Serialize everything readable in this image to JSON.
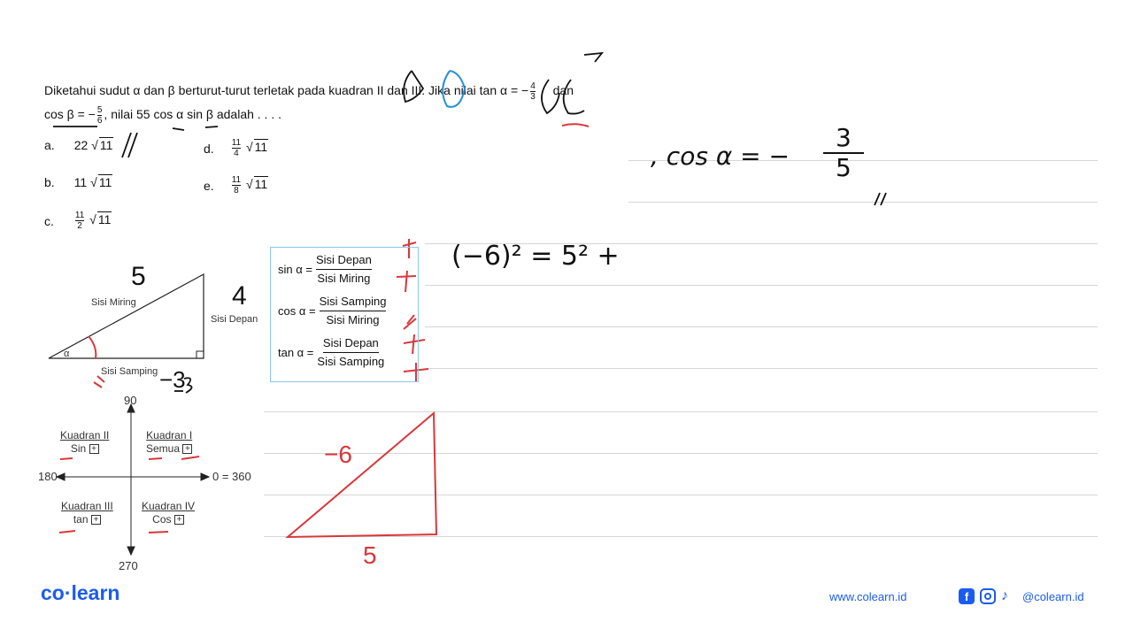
{
  "question": {
    "line1": "Diketahui sudut α dan β berturut-turut terletak pada kuadran II dan III. Jika nilai tan α = −",
    "tan_num": "4",
    "tan_den": "3",
    "line1_end": "dan",
    "line2_a": "cos β = −",
    "cos_num": "5",
    "cos_den": "6",
    "line2_b": ", nilai 55 cos α sin β adalah . . . ."
  },
  "options": [
    {
      "letter": "a.",
      "coef": "22",
      "rad": "11"
    },
    {
      "letter": "b.",
      "coef": "11",
      "rad": "11"
    },
    {
      "letter": "c.",
      "num": "11",
      "den": "2",
      "rad": "11"
    },
    {
      "letter": "d.",
      "num": "11",
      "den": "4",
      "rad": "11"
    },
    {
      "letter": "e.",
      "num": "11",
      "den": "8",
      "rad": "11"
    }
  ],
  "triangle": {
    "hyp": "Sisi Miring",
    "opp": "Sisi Depan",
    "adj": "Sisi Samping",
    "angle": "α"
  },
  "formulas": [
    {
      "lhs": "sin α =",
      "num": "Sisi Depan",
      "den": "Sisi Miring"
    },
    {
      "lhs": "cos α =",
      "num": "Sisi Samping",
      "den": "Sisi Miring"
    },
    {
      "lhs": "tan α =",
      "num": "Sisi Depan",
      "den": "Sisi Samping"
    }
  ],
  "quadrants": {
    "axis": {
      "top": "90",
      "left": "180",
      "right": "0 = 360",
      "bottom": "270"
    },
    "items": [
      {
        "name": "Kuadran II",
        "fn": "Sin"
      },
      {
        "name": "Kuadran I",
        "fn": "Semua"
      },
      {
        "name": "Kuadran III",
        "fn": "tan"
      },
      {
        "name": "Kuadran IV",
        "fn": "Cos"
      }
    ],
    "sign": "+"
  },
  "handwriting": {
    "cos_alpha": ", cos α = −",
    "cos_num": "3",
    "cos_den": "5",
    "mark": "//",
    "eq": "(−6)² = 5² +",
    "tri_label_side": "−6",
    "tri_label_base": "5",
    "hyp_value": "5",
    "opp_value": "4",
    "adj_value": "−3",
    "check": "//"
  },
  "footer": {
    "logo": "co·learn",
    "website": "www.colearn.id",
    "handle": "@colearn.id"
  },
  "colors": {
    "brand": "#1b5cf0",
    "ink_red": "#d9373b",
    "ink_blue": "#2a8fd8",
    "box_border": "#8cc8e6"
  }
}
